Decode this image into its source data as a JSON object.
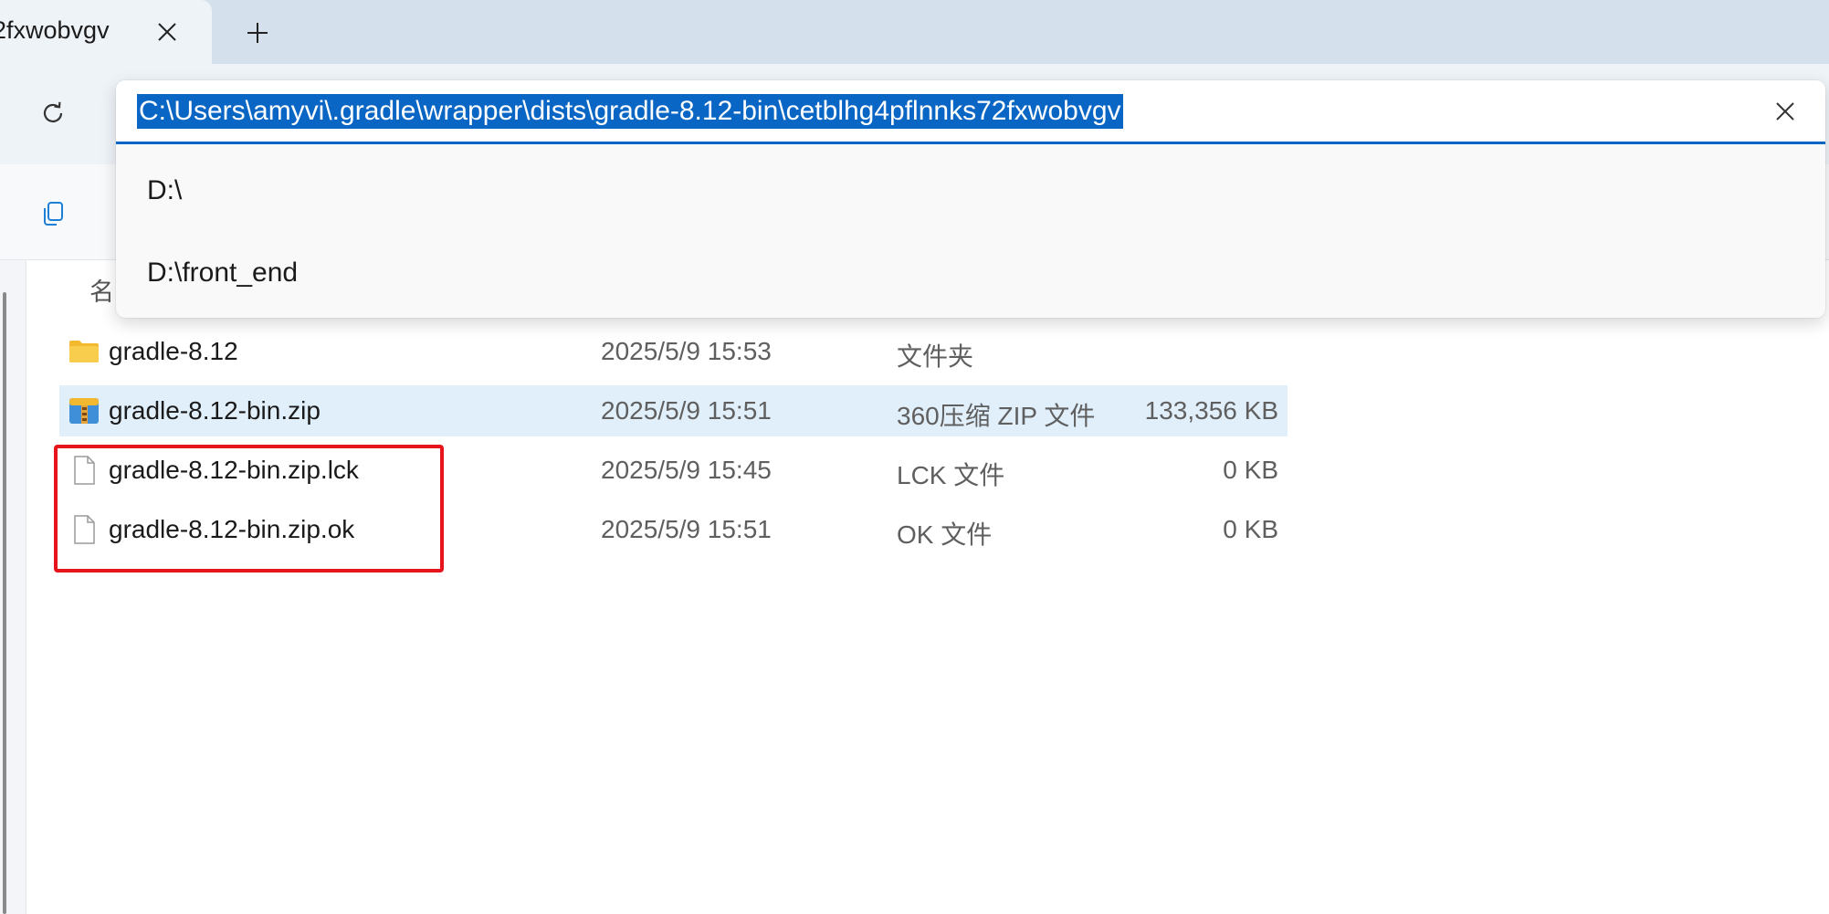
{
  "tab": {
    "title": "2fxwobvgv",
    "close_icon": "close-icon",
    "new_tab_icon": "plus-icon"
  },
  "nav": {
    "refresh_icon": "refresh-icon",
    "address": {
      "value": "C:\\Users\\amyvi\\.gradle\\wrapper\\dists\\gradle-8.12-bin\\cetblhg4pflnnks72fxwobvgv",
      "selected": true,
      "clear_icon": "close-icon"
    },
    "suggestions": [
      "D:\\",
      "D:\\front_end"
    ]
  },
  "command_bar": {
    "copy_icon": "copy-icon"
  },
  "list": {
    "header_name": "名",
    "rows": [
      {
        "name": "gradle-8.12",
        "date": "2025/5/9 15:53",
        "type": "文件夹",
        "size": "",
        "icon": "folder-icon",
        "selected": false
      },
      {
        "name": "gradle-8.12-bin.zip",
        "date": "2025/5/9 15:51",
        "type": "360压缩 ZIP 文件",
        "size": "133,356 KB",
        "icon": "zip-archive-icon",
        "selected": true
      },
      {
        "name": "gradle-8.12-bin.zip.lck",
        "date": "2025/5/9 15:45",
        "type": "LCK 文件",
        "size": "0 KB",
        "icon": "file-icon",
        "selected": false
      },
      {
        "name": "gradle-8.12-bin.zip.ok",
        "date": "2025/5/9 15:51",
        "type": "OK 文件",
        "size": "0 KB",
        "icon": "file-icon",
        "selected": false
      }
    ]
  },
  "colors": {
    "accent": "#0a66c4",
    "selection_row": "#e1effb",
    "annotation_box": "#e8141c",
    "folder": "#f5c342"
  }
}
